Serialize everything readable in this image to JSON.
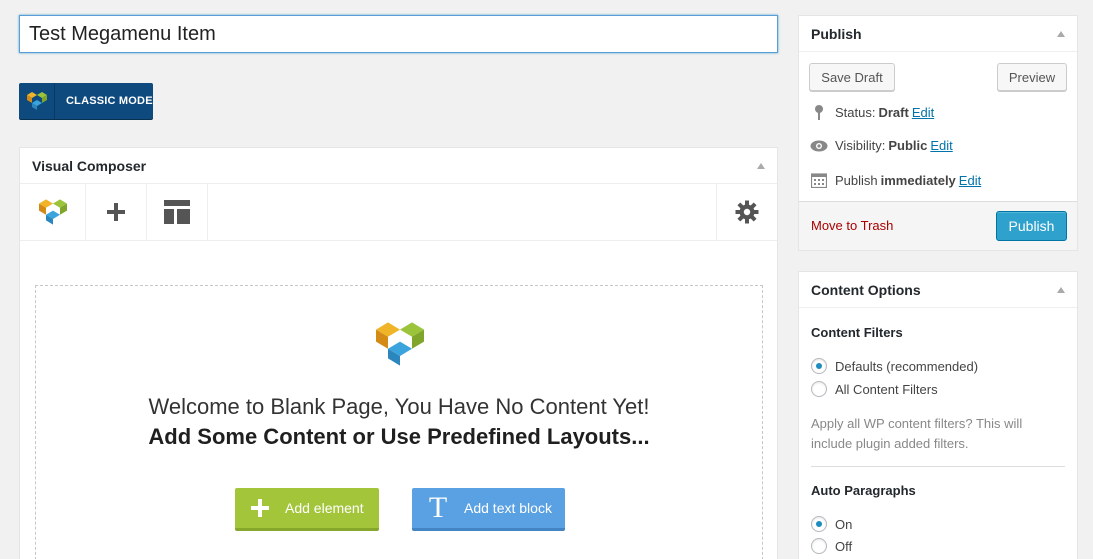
{
  "post": {
    "title": "Test Megamenu Item"
  },
  "classic_mode": {
    "label": "CLASSIC MODE"
  },
  "visual_composer": {
    "title": "Visual Composer",
    "toolbar": {
      "logo": "vc-logo-icon",
      "add": "plus-icon",
      "templates": "layout-icon",
      "settings": "gear-icon"
    },
    "welcome_line1": "Welcome to Blank Page, You Have No Content Yet!",
    "welcome_line2": "Add Some Content or Use Predefined Layouts...",
    "add_element_label": "Add element",
    "add_text_block_label": "Add text block",
    "add_text_icon_glyph": "T"
  },
  "publish": {
    "title": "Publish",
    "save_draft": "Save Draft",
    "preview": "Preview",
    "status_label": "Status:",
    "status_value": "Draft",
    "visibility_label": "Visibility:",
    "visibility_value": "Public",
    "publish_label": "Publish",
    "publish_value": "immediately",
    "edit_link": "Edit",
    "move_to_trash": "Move to Trash",
    "publish_button": "Publish"
  },
  "content_options": {
    "title": "Content Options",
    "filters_title": "Content Filters",
    "filter_defaults": "Defaults (recommended)",
    "filter_all": "All Content Filters",
    "filters_help": "Apply all WP content filters? This will include plugin added filters.",
    "auto_p_title": "Auto Paragraphs",
    "auto_p_on": "On",
    "auto_p_off": "Off"
  },
  "colors": {
    "accent_blue": "#2ea2cc",
    "classic_bg": "#0e4a7e",
    "add_element_green": "#a3c53a",
    "add_text_blue": "#5aa1e3",
    "trash_red": "#a00",
    "link_blue": "#0073aa"
  }
}
